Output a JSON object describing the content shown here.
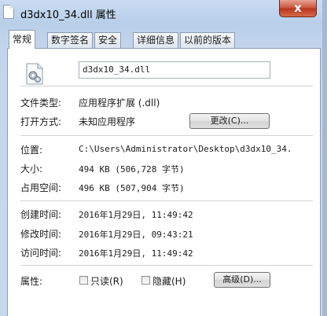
{
  "window": {
    "title": "d3dx10_34.dll 属性",
    "close_glyph": "x"
  },
  "tabs": [
    {
      "label": "常规",
      "active": true
    },
    {
      "label": "数字签名",
      "active": false
    },
    {
      "label": "安全",
      "active": false
    },
    {
      "label": "详细信息",
      "active": false
    },
    {
      "label": "以前的版本",
      "active": false
    }
  ],
  "general": {
    "file_name": "d3dx10_34.dll",
    "file_type_label": "文件类型:",
    "file_type_value": "应用程序扩展 (.dll)",
    "opens_with_label": "打开方式:",
    "opens_with_value": "未知应用程序",
    "change_button": "更改(C)...",
    "location_label": "位置:",
    "location_value": "C:\\Users\\Administrator\\Desktop\\d3dx10_34.",
    "size_label": "大小:",
    "size_value": "494 KB (506,728 字节)",
    "size_on_disk_label": "占用空间:",
    "size_on_disk_value": "496 KB (507,904 字节)",
    "created_label": "创建时间:",
    "created_value": "2016年1月29日, 11:49:42",
    "modified_label": "修改时间:",
    "modified_value": "2016年1月29日, 09:43:21",
    "accessed_label": "访问时间:",
    "accessed_value": "2016年1月29日, 11:49:42",
    "attributes_label": "属性:",
    "readonly_label": "只读(R)",
    "readonly_checked": false,
    "hidden_label": "隐藏(H)",
    "hidden_checked": false,
    "advanced_button": "高级(D)..."
  },
  "colors": {
    "window_frame": "#bfd3ec",
    "close_button": "#c7523c",
    "tab_border": "#8c9cb0"
  },
  "icons": {
    "title_icon": "file-icon",
    "file_icon": "dll-settings-file-icon"
  }
}
